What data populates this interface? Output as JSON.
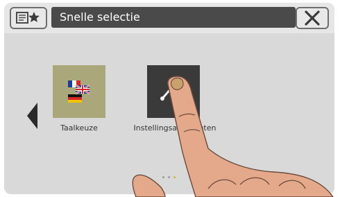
{
  "header": {
    "title": "Snelle selectie",
    "favorites_icon": "list-star-icon",
    "close_icon": "close-icon"
  },
  "apps": [
    {
      "label": "Taalkeuze",
      "icon": "language-flags-icon",
      "color": "#aaa77a"
    },
    {
      "label": "Instellingsassistenten",
      "icon": "settings-wizard-icon",
      "color": "#3a3a3a"
    }
  ],
  "navigation": {
    "left_arrow_icon": "chevron-left-icon"
  },
  "pagination": {
    "current_page": 3,
    "total_pages": 3
  }
}
